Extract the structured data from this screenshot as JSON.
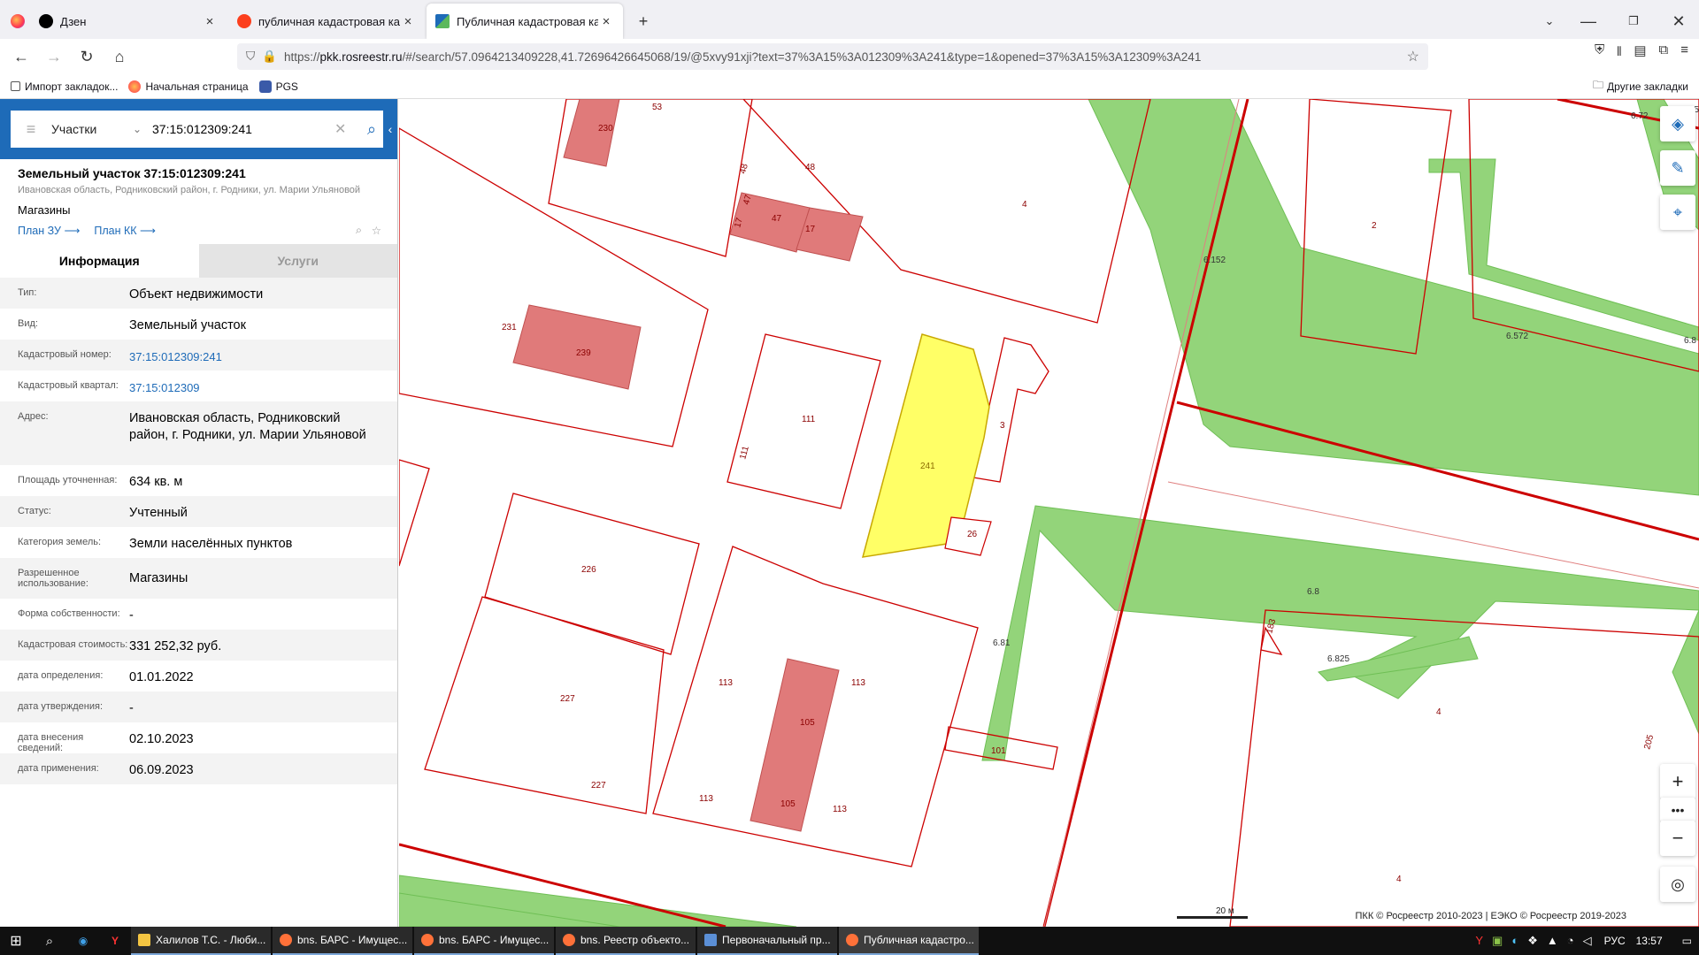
{
  "browser": {
    "tabs": [
      {
        "title": "Дзен",
        "active": false
      },
      {
        "title": "публичная кадастровая карта",
        "active": false
      },
      {
        "title": "Публичная кадастровая карта",
        "active": true
      }
    ],
    "new_tab": "+",
    "url_prefix": "https://",
    "url_host": "pkk.rosreestr.ru",
    "url_rest": "/#/search/57.0964213409228,41.72696426645068/19/@5xvy91xji?text=37%3A15%3A012309%3A241&type=1&opened=37%3A15%3A12309%3A241",
    "bookmarks": [
      "Импорт закладок...",
      "Начальная страница",
      "PGS"
    ],
    "other_bookmarks": "Другие закладки"
  },
  "panel": {
    "search_type": "Участки",
    "search_value": "37:15:012309:241",
    "title": "Земельный участок 37:15:012309:241",
    "address_short": "Ивановская область, Родниковский район, г. Родники, ул. Марии Ульяновой",
    "use": "Магазины",
    "plan_zu": "План ЗУ",
    "plan_kk": "План КК",
    "tab_info": "Информация",
    "tab_services": "Услуги",
    "rows": [
      {
        "k": "Тип:",
        "v": "Объект недвижимости"
      },
      {
        "k": "Вид:",
        "v": "Земельный участок"
      },
      {
        "k": "Кадастровый номер:",
        "v": "37:15:012309:241"
      },
      {
        "k": "Кадастровый квартал:",
        "v": "37:15:012309"
      },
      {
        "k": "Адрес:",
        "v": "Ивановская область, Родниковский район, г. Родники, ул. Марии Ульяновой"
      },
      {
        "k": "Площадь уточненная:",
        "v": "634 кв. м"
      },
      {
        "k": "Статус:",
        "v": "Учтенный"
      },
      {
        "k": "Категория земель:",
        "v": "Земли населённых пунктов"
      },
      {
        "k": "Разрешенное использование:",
        "v": "Магазины"
      },
      {
        "k": "Форма собственности:",
        "v": "-"
      },
      {
        "k": "Кадастровая стоимость:",
        "v": "331 252,32 руб."
      },
      {
        "k": "дата определения:",
        "v": "01.01.2022"
      },
      {
        "k": "дата утверждения:",
        "v": "-"
      },
      {
        "k": "дата внесения сведений:",
        "v": "02.10.2023"
      },
      {
        "k": "дата применения:",
        "v": "06.09.2023"
      }
    ]
  },
  "map": {
    "labels": [
      "53",
      "230",
      "48",
      "48",
      "47",
      "47",
      "17",
      "17",
      "4",
      "6.152",
      "2",
      "6.572",
      "6.8",
      "6.72",
      "231",
      "239",
      "111",
      "111",
      "241",
      "3",
      "26",
      "226",
      "227",
      "227",
      "113",
      "113",
      "113",
      "113",
      "105",
      "105",
      "6.81",
      "101",
      "6.8",
      "183",
      "6.825",
      "4",
      "205",
      "4",
      "6.725"
    ],
    "copyright": "ПКК © Росреестр 2010-2023 | ЕЭКО © Росреестр 2019-2023",
    "scale": "20 м"
  },
  "taskbar": {
    "items": [
      "Халилов Т.С. - Люби...",
      "bns. БАРС - Имущес...",
      "bns. БАРС - Имущес...",
      "bns. Реестр объекто...",
      "Первоначальный пр...",
      "Публичная кадастро..."
    ],
    "lang": "РУС",
    "time": "13:57"
  },
  "colors": {
    "accent": "#1e6bb8",
    "parcel_line": "#cc0000",
    "green": "#93d47a",
    "building": "#e07a7a",
    "selected": "#ffff66"
  }
}
